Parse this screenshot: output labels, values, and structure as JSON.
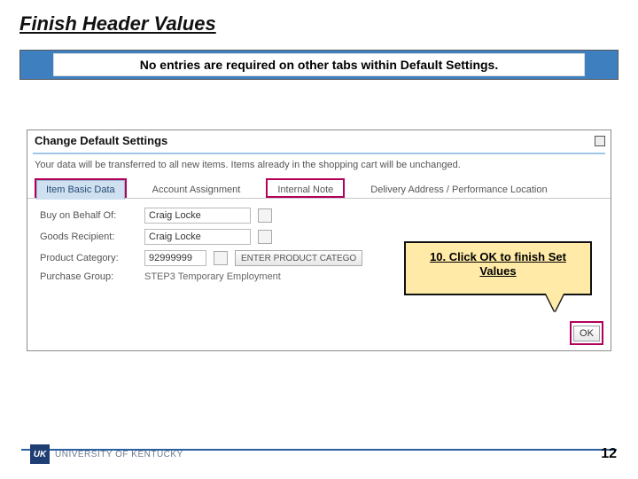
{
  "slide": {
    "title": "Finish Header Values",
    "notice": "No entries are required on other tabs within Default Settings."
  },
  "panel": {
    "title": "Change Default Settings",
    "help_text": "Your data will be transferred to all new items. Items already in the shopping cart will be unchanged.",
    "tabs": {
      "item_basic": "Item Basic Data",
      "account_assignment": "Account Assignment",
      "internal_note": "Internal Note",
      "delivery": "Delivery Address / Performance Location"
    },
    "fields": {
      "buy_on_behalf": {
        "label": "Buy on Behalf Of:",
        "value": "Craig Locke"
      },
      "goods_recipient": {
        "label": "Goods Recipient:",
        "value": "Craig Locke"
      },
      "product_category": {
        "label": "Product Category:",
        "value": "92999999",
        "button": "ENTER PRODUCT CATEGO"
      },
      "purchase_group": {
        "label": "Purchase Group:",
        "value": "STEP3 Temporary Employment"
      }
    },
    "ok_label": "OK"
  },
  "callout": {
    "text": "10. Click OK to finish Set Values"
  },
  "footer": {
    "org_badge": "UK",
    "org_name": "UNIVERSITY OF KENTUCKY",
    "page": "12"
  }
}
